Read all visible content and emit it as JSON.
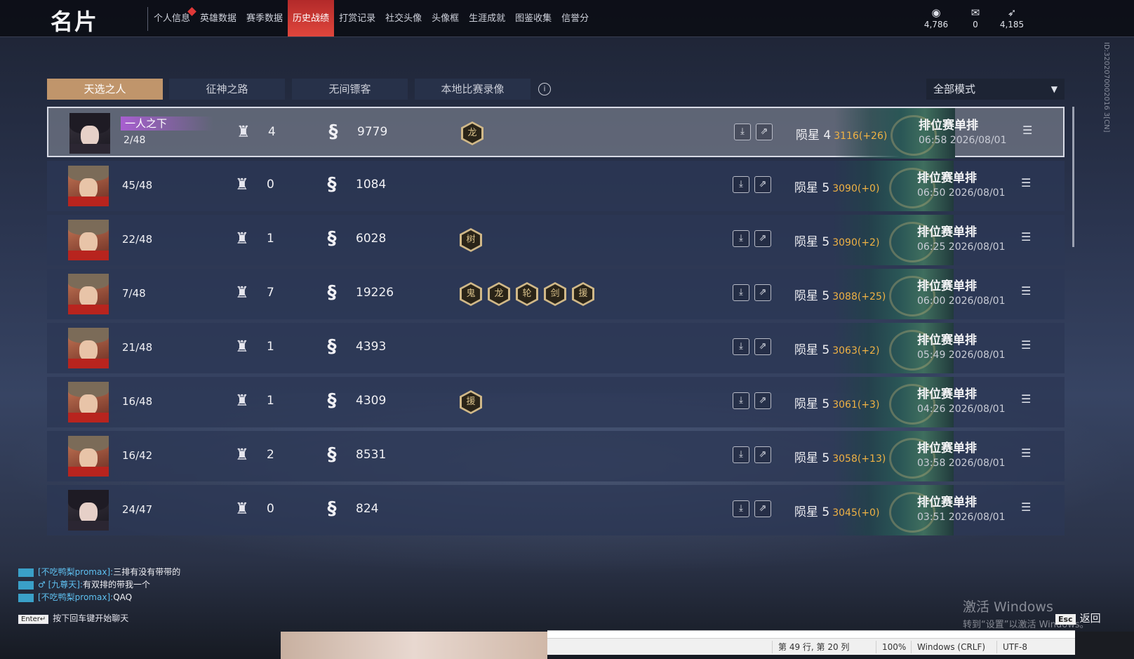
{
  "app": {
    "title": "名片"
  },
  "nav": {
    "items": [
      {
        "label": "个人信息",
        "dot": true
      },
      {
        "label": "英雄数据"
      },
      {
        "label": "赛季数据"
      },
      {
        "label": "历史战绩",
        "active": true
      },
      {
        "label": "打赏记录"
      },
      {
        "label": "社交头像"
      },
      {
        "label": "头像框"
      },
      {
        "label": "生涯成就"
      },
      {
        "label": "图鉴收集"
      },
      {
        "label": "信誉分"
      }
    ]
  },
  "resources": [
    {
      "icon": "eye-coin-icon",
      "value": "4,786"
    },
    {
      "icon": "ticket-icon",
      "value": "0"
    },
    {
      "icon": "feather-icon",
      "value": "4,185"
    }
  ],
  "tabs": [
    {
      "label": "天选之人",
      "active": true
    },
    {
      "label": "征神之路"
    },
    {
      "label": "无间镖客"
    },
    {
      "label": "本地比赛录像"
    }
  ],
  "mode_select": {
    "value": "全部模式"
  },
  "matches": [
    {
      "tag": "一人之下",
      "rank": "2/48",
      "kills": "4",
      "damage": "9779",
      "badges": [
        "龙"
      ],
      "tier": "陨星 4",
      "score": "3116(+26)",
      "type": "排位赛单排",
      "time": "06:58  2026/08/01",
      "avatar": "female"
    },
    {
      "rank": "45/48",
      "kills": "0",
      "damage": "1084",
      "badges": [],
      "tier": "陨星 5",
      "score": "3090(+0)",
      "type": "排位赛单排",
      "time": "06:50  2026/08/01",
      "avatar": "male"
    },
    {
      "rank": "22/48",
      "kills": "1",
      "damage": "6028",
      "badges": [
        "树"
      ],
      "tier": "陨星 5",
      "score": "3090(+2)",
      "type": "排位赛单排",
      "time": "06:25  2026/08/01",
      "avatar": "male"
    },
    {
      "rank": "7/48",
      "kills": "7",
      "damage": "19226",
      "badges": [
        "鬼",
        "龙",
        "轮",
        "剑",
        "援"
      ],
      "tier": "陨星 5",
      "score": "3088(+25)",
      "type": "排位赛单排",
      "time": "06:00  2026/08/01",
      "avatar": "male"
    },
    {
      "rank": "21/48",
      "kills": "1",
      "damage": "4393",
      "badges": [],
      "tier": "陨星 5",
      "score": "3063(+2)",
      "type": "排位赛单排",
      "time": "05:49  2026/08/01",
      "avatar": "male"
    },
    {
      "rank": "16/48",
      "kills": "1",
      "damage": "4309",
      "badges": [
        "援"
      ],
      "tier": "陨星 5",
      "score": "3061(+3)",
      "type": "排位赛单排",
      "time": "04:26  2026/08/01",
      "avatar": "male"
    },
    {
      "rank": "16/42",
      "kills": "2",
      "damage": "8531",
      "badges": [],
      "tier": "陨星 5",
      "score": "3058(+13)",
      "type": "排位赛单排",
      "time": "03:58  2026/08/01",
      "avatar": "male"
    },
    {
      "rank": "24/47",
      "kills": "0",
      "damage": "824",
      "badges": [],
      "tier": "陨星 5",
      "score": "3045(+0)",
      "type": "排位赛单排",
      "time": "03:51  2026/08/01",
      "avatar": "female"
    }
  ],
  "side_id": "ID:3202070002016 3[CN]",
  "chat": [
    {
      "name": "[不吃鸭梨promax]:",
      "msg": "三排有没有带带的"
    },
    {
      "name": "♂ [九尊天]:",
      "msg": "有双排的带我一个"
    },
    {
      "name": "[不吃鸭梨promax]:",
      "msg": "QAQ"
    }
  ],
  "chat_hint": {
    "key": "Enter↵",
    "text": "按下回车键开始聊天"
  },
  "watermark": {
    "line1": "激活 Windows",
    "line2": "转到“设置”以激活 Windows。"
  },
  "esc": {
    "key": "Esc",
    "label": "返回"
  },
  "notepad_status": {
    "position": "第 49 行, 第 20 列",
    "zoom": "100%",
    "eol": "Windows (CRLF)",
    "encoding": "UTF-8"
  }
}
